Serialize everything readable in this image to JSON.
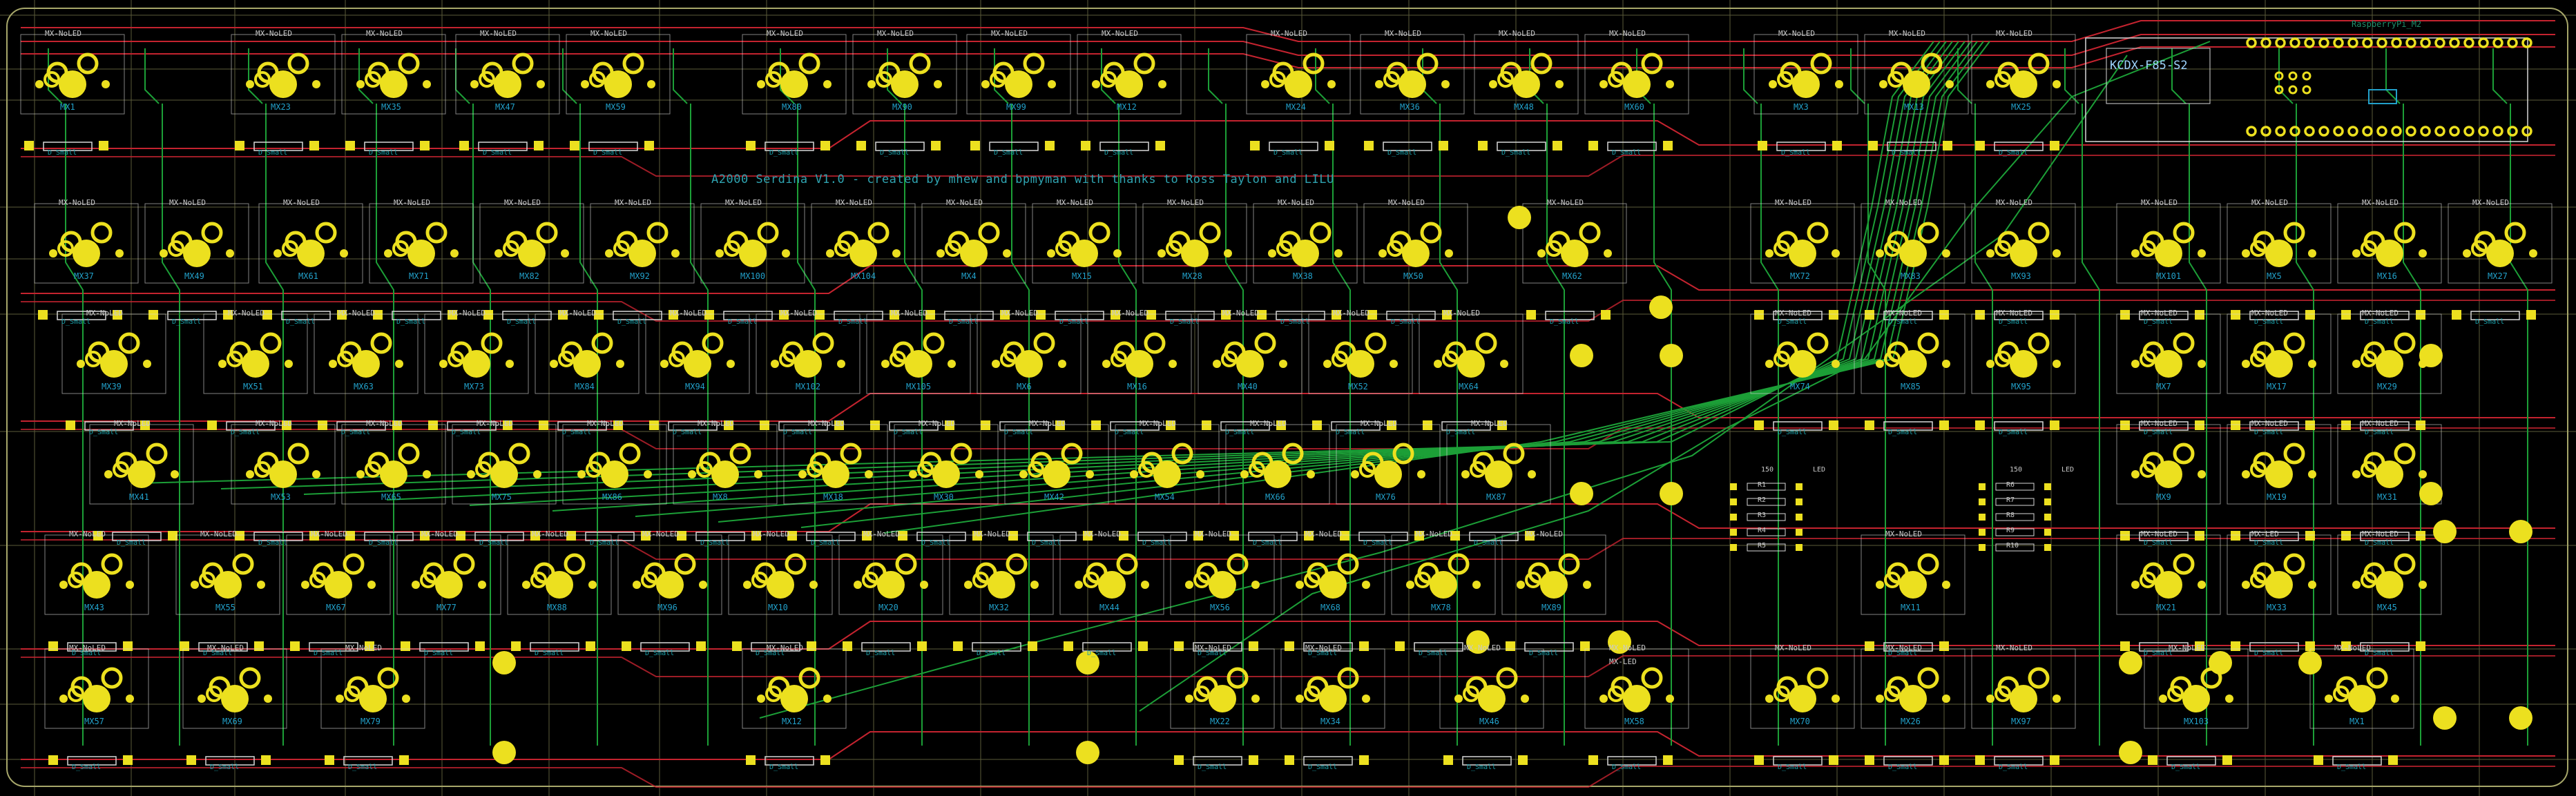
{
  "board": {
    "title": "A2000 Serdina V1.0 - created by mhew and bpmyman with thanks to Ross Taylon and LILU",
    "mcu_label": "KCDX-F85-S2",
    "mcu_sub": "RaspberryPi_M2",
    "footprint_top": "MX-NoLED",
    "footprint_top_led": "MX-LED",
    "diode_label": "D_Small",
    "colors": {
      "background": "#000000",
      "grid": "#a7a76a",
      "front_copper": "#c4232f",
      "back_copper": "#1c9f37",
      "pad": "#ece01f",
      "silk": "#d8d8d8",
      "fab_text": "#22a0c9"
    }
  },
  "switches": [
    {
      "ref": "MX1",
      "top": "MX-NoLED",
      "diode": "D_Small"
    },
    {
      "ref": "MX23",
      "top": "MX-NoLED",
      "diode": "D_Small"
    },
    {
      "ref": "MX35",
      "top": "MX-NoLED",
      "diode": "D_Small"
    },
    {
      "ref": "MX47",
      "top": "MX-NoLED",
      "diode": "D_Small"
    },
    {
      "ref": "MX59",
      "top": "MX-NoLED",
      "diode": "D_Small"
    },
    {
      "ref": "MX80",
      "top": "MX-NoLED",
      "diode": "D_Small"
    },
    {
      "ref": "MX90",
      "top": "MX-NoLED",
      "diode": "D_Small"
    },
    {
      "ref": "MX99",
      "top": "MX-NoLED",
      "diode": "D_Small"
    },
    {
      "ref": "MX12",
      "top": "MX-NoLED",
      "diode": "D_Small"
    },
    {
      "ref": "MX24",
      "top": "MX-NoLED",
      "diode": "D_Small"
    },
    {
      "ref": "MX36",
      "top": "MX-NoLED",
      "diode": "D_Small"
    },
    {
      "ref": "MX48",
      "top": "MX-NoLED",
      "diode": "D_Small"
    },
    {
      "ref": "MX60",
      "top": "MX-NoLED",
      "diode": "D_Small"
    },
    {
      "ref": "MX3",
      "top": "MX-NoLED",
      "diode": "D_Small"
    },
    {
      "ref": "MX13",
      "top": "MX-NoLED",
      "diode": "D_Small"
    },
    {
      "ref": "MX25",
      "top": "MX-NoLED",
      "diode": "D_Small"
    },
    {
      "ref": "MX37",
      "top": "MX-NoLED",
      "diode": "D_Small"
    },
    {
      "ref": "MX49",
      "top": "MX-NoLED",
      "diode": "D_Small"
    },
    {
      "ref": "MX61",
      "top": "MX-NoLED",
      "diode": "D_Small"
    },
    {
      "ref": "MX71",
      "top": "MX-NoLED",
      "diode": "D_Small"
    },
    {
      "ref": "MX82",
      "top": "MX-NoLED",
      "diode": "D_Small"
    },
    {
      "ref": "MX92",
      "top": "MX-NoLED",
      "diode": "D_Small"
    },
    {
      "ref": "MX100",
      "top": "MX-NoLED",
      "diode": "D_Small"
    },
    {
      "ref": "MX104",
      "top": "MX-NoLED",
      "diode": "D_Small"
    },
    {
      "ref": "MX4",
      "top": "MX-NoLED",
      "diode": "D_Small"
    },
    {
      "ref": "MX15",
      "top": "MX-NoLED",
      "diode": "D_Small"
    },
    {
      "ref": "MX28",
      "top": "MX-NoLED",
      "diode": "D_Small"
    },
    {
      "ref": "MX38",
      "top": "MX-NoLED",
      "diode": "D_Small"
    },
    {
      "ref": "MX50",
      "top": "MX-NoLED",
      "diode": "D_Small"
    },
    {
      "ref": "MX62",
      "top": "MX-NoLED",
      "diode": "D_Small"
    },
    {
      "ref": "MX72",
      "top": "MX-NoLED",
      "diode": "D_Small"
    },
    {
      "ref": "MX83",
      "top": "MX-NoLED",
      "diode": "D_Small"
    },
    {
      "ref": "MX93",
      "top": "MX-NoLED",
      "diode": "D_Small"
    },
    {
      "ref": "MX101",
      "top": "MX-NoLED",
      "diode": "D_Small"
    },
    {
      "ref": "MX5",
      "top": "MX-NoLED",
      "diode": "D_Small"
    },
    {
      "ref": "MX16",
      "top": "MX-NoLED",
      "diode": "D_Small"
    },
    {
      "ref": "MX27",
      "top": "MX-NoLED",
      "diode": "D_Small"
    },
    {
      "ref": "MX39",
      "top": "MX-NoLED",
      "diode": "D_Small"
    },
    {
      "ref": "MX51",
      "top": "MX-NoLED",
      "diode": "D_Small"
    },
    {
      "ref": "MX63",
      "top": "MX-NoLED",
      "diode": "D_Small"
    },
    {
      "ref": "MX73",
      "top": "MX-NoLED",
      "diode": "D_Small"
    },
    {
      "ref": "MX84",
      "top": "MX-NoLED",
      "diode": "D_Small"
    },
    {
      "ref": "MX94",
      "top": "MX-NoLED",
      "diode": "D_Small"
    },
    {
      "ref": "MX102",
      "top": "MX-NoLED",
      "diode": "D_Small"
    },
    {
      "ref": "MX105",
      "top": "MX-NoLED",
      "diode": "D_Small"
    },
    {
      "ref": "MX6",
      "top": "MX-NoLED",
      "diode": "D_Small"
    },
    {
      "ref": "MX16",
      "top": "MX-NoLED",
      "diode": "D_Small"
    },
    {
      "ref": "MX40",
      "top": "MX-NoLED",
      "diode": "D_Small"
    },
    {
      "ref": "MX52",
      "top": "MX-NoLED",
      "diode": "D_Small"
    },
    {
      "ref": "MX64",
      "top": "MX-NoLED",
      "diode": "D_Small"
    },
    {
      "ref": "MX74",
      "top": "MX-NoLED",
      "diode": "D_Small"
    },
    {
      "ref": "MX85",
      "top": "MX-NoLED",
      "diode": "D_Small"
    },
    {
      "ref": "MX95",
      "top": "MX-NoLED",
      "diode": "D_Small"
    },
    {
      "ref": "MX7",
      "top": "MX-NoLED",
      "diode": "D_Small"
    },
    {
      "ref": "MX17",
      "top": "MX-NoLED",
      "diode": "D_Small"
    },
    {
      "ref": "MX29",
      "top": "MX-NoLED",
      "diode": "D_Small"
    },
    {
      "ref": "MX41",
      "top": "MX-NoLED",
      "diode": "D_Small"
    },
    {
      "ref": "MX53",
      "top": "MX-NoLED",
      "diode": "D_Small"
    },
    {
      "ref": "MX65",
      "top": "MX-NoLED",
      "diode": "D_Small"
    },
    {
      "ref": "MX75",
      "top": "MX-NoLED",
      "diode": "D_Small"
    },
    {
      "ref": "MX86",
      "top": "MX-NoLED",
      "diode": "D_Small"
    },
    {
      "ref": "MX8",
      "top": "MX-NoLED",
      "diode": "D_Small"
    },
    {
      "ref": "MX18",
      "top": "MX-NoLED",
      "diode": "D_Small"
    },
    {
      "ref": "MX30",
      "top": "MX-NoLED",
      "diode": "D_Small"
    },
    {
      "ref": "MX42",
      "top": "MX-NoLED",
      "diode": "D_Small"
    },
    {
      "ref": "MX54",
      "top": "MX-NoLED",
      "diode": "D_Small"
    },
    {
      "ref": "MX66",
      "top": "MX-NoLED",
      "diode": "D_Small"
    },
    {
      "ref": "MX76",
      "top": "MX-NoLED",
      "diode": "D_Small"
    },
    {
      "ref": "MX87",
      "top": "MX-NoLED",
      "diode": "D_Small"
    },
    {
      "ref": "MX9",
      "top": "MX-NoLED",
      "diode": "D_Small"
    },
    {
      "ref": "MX19",
      "top": "MX-NoLED",
      "diode": "D_Small"
    },
    {
      "ref": "MX31",
      "top": "MX-NoLED",
      "diode": "D_Small"
    },
    {
      "ref": "MX43",
      "top": "MX-NoLED",
      "diode": "D_Small"
    },
    {
      "ref": "MX55",
      "top": "MX-NoLED",
      "diode": "D_Small"
    },
    {
      "ref": "MX67",
      "top": "MX-NoLED",
      "diode": "D_Small"
    },
    {
      "ref": "MX77",
      "top": "MX-NoLED",
      "diode": "D_Small"
    },
    {
      "ref": "MX88",
      "top": "MX-NoLED",
      "diode": "D_Small"
    },
    {
      "ref": "MX96",
      "top": "MX-NoLED",
      "diode": "D_Small"
    },
    {
      "ref": "MX10",
      "top": "MX-NoLED",
      "diode": "D_Small"
    },
    {
      "ref": "MX20",
      "top": "MX-NoLED",
      "diode": "D_Small"
    },
    {
      "ref": "MX32",
      "top": "MX-NoLED",
      "diode": "D_Small"
    },
    {
      "ref": "MX44",
      "top": "MX-NoLED",
      "diode": "D_Small"
    },
    {
      "ref": "MX56",
      "top": "MX-NoLED",
      "diode": "D_Small"
    },
    {
      "ref": "MX68",
      "top": "MX-NoLED",
      "diode": "D_Small"
    },
    {
      "ref": "MX78",
      "top": "MX-NoLED",
      "diode": "D_Small"
    },
    {
      "ref": "MX89",
      "top": "MX-NoLED",
      "diode": "D_Small"
    },
    {
      "ref": "MX11",
      "top": "MX-NoLED",
      "diode": "D_Small"
    },
    {
      "ref": "MX21",
      "top": "MX-NoLED",
      "diode": "D_Small"
    },
    {
      "ref": "MX33",
      "top": "MX-LED",
      "diode": "D_Small"
    },
    {
      "ref": "MX45",
      "top": "MX-NoLED",
      "diode": "D_Small"
    },
    {
      "ref": "MX57",
      "top": "MX-NoLED",
      "diode": "D_Small"
    },
    {
      "ref": "MX69",
      "top": "MX-NoLED",
      "diode": "D_Small"
    },
    {
      "ref": "MX79",
      "top": "MX-NoLED",
      "diode": "D_Small"
    },
    {
      "ref": "MX12",
      "top": "MX-NoLED",
      "diode": "D_Small"
    },
    {
      "ref": "MX22",
      "top": "MX-NoLED",
      "diode": "D_Small"
    },
    {
      "ref": "MX34",
      "top": "MX-NoLED",
      "diode": "D_Small"
    },
    {
      "ref": "MX46",
      "top": "MX-NoLED",
      "diode": "D_Small"
    },
    {
      "ref": "MX58",
      "top": "MX-NoLED",
      "diode": "D_Small"
    },
    {
      "ref": "MX70",
      "top": "MX-NoLED",
      "diode": "D_Small"
    },
    {
      "ref": "MX26",
      "top": "MX-NoLED",
      "diode": "D_Small"
    },
    {
      "ref": "MX97",
      "top": "MX-NoLED",
      "diode": "D_Small"
    },
    {
      "ref": "MX103",
      "top": "MX-NoLED",
      "diode": "D_Small"
    }
  ],
  "resistors": [
    "R1",
    "R2",
    "R3",
    "R4",
    "R5",
    "R6",
    "R7",
    "R8",
    "R9",
    "R10"
  ],
  "resistor_value": "150",
  "led_label": "LED"
}
